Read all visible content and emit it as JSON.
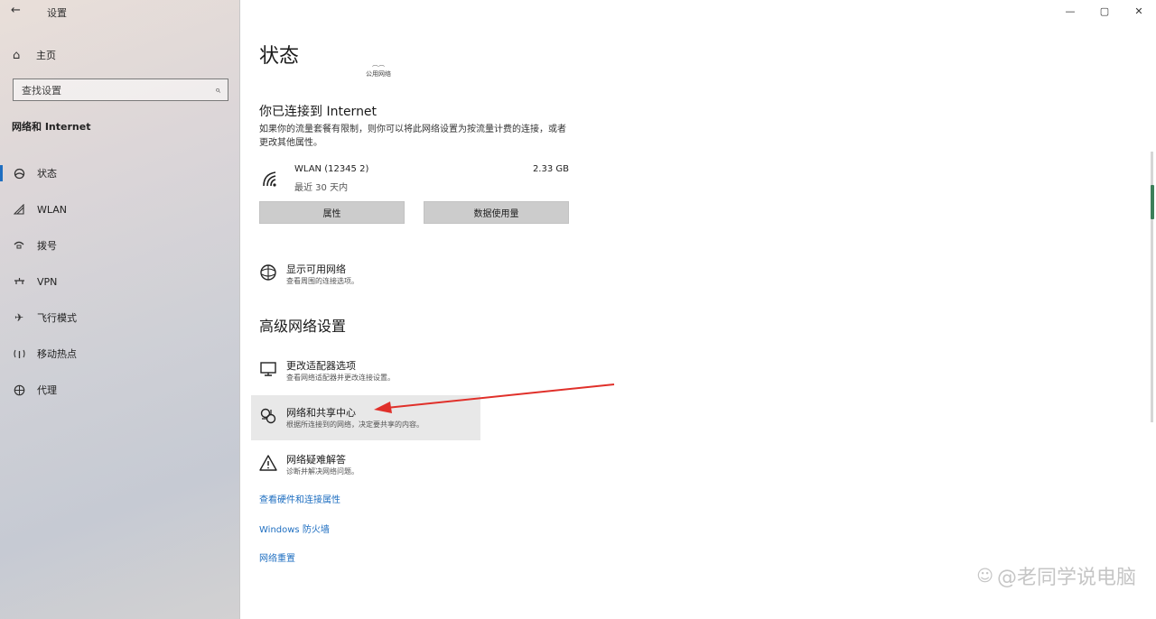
{
  "window": {
    "back_glyph": "←",
    "title": "设置",
    "controls": {
      "minimize": "—",
      "maximize": "▢",
      "close": "✕"
    }
  },
  "sidebar": {
    "home_label": "主页",
    "search_placeholder": "查找设置",
    "section_label": "网络和 Internet",
    "items": [
      {
        "label": "状态",
        "icon": "status-icon",
        "active": true
      },
      {
        "label": "WLAN",
        "icon": "wifi-icon",
        "active": false
      },
      {
        "label": "拨号",
        "icon": "dialup-icon",
        "active": false
      },
      {
        "label": "VPN",
        "icon": "vpn-icon",
        "active": false
      },
      {
        "label": "飞行模式",
        "icon": "airplane-icon",
        "active": false
      },
      {
        "label": "移动热点",
        "icon": "hotspot-icon",
        "active": false
      },
      {
        "label": "代理",
        "icon": "globe-icon",
        "active": false
      }
    ]
  },
  "main": {
    "title": "状态",
    "connection_sub": "公用网络",
    "connected_heading": "你已连接到 Internet",
    "connected_desc": "如果你的流量套餐有限制，则你可以将此网络设置为按流量计费的连接，或者更改其他属性。",
    "adapter": {
      "name": "WLAN (12345 2)",
      "since": "最近 30 天内",
      "usage": "2.33 GB"
    },
    "buttons": {
      "properties": "属性",
      "data_usage": "数据使用量"
    },
    "show_networks": {
      "title": "显示可用网络",
      "desc": "查看周围的连接选项。"
    },
    "advanced_heading": "高级网络设置",
    "advanced_items": [
      {
        "title": "更改适配器选项",
        "desc": "查看网络适配器并更改连接设置。",
        "icon": "monitor-icon"
      },
      {
        "title": "网络和共享中心",
        "desc": "根据所连接到的网络，决定要共享的内容。",
        "icon": "sharing-icon"
      },
      {
        "title": "网络疑难解答",
        "desc": "诊断并解决网络问题。",
        "icon": "warning-icon"
      }
    ],
    "links": [
      "查看硬件和连接属性",
      "Windows 防火墙",
      "网络重置"
    ]
  },
  "annotation": {
    "color": "#e0302a"
  },
  "watermark": {
    "text": "@老同学说电脑"
  },
  "colors": {
    "accent": "#1f6fc1",
    "button_bg": "#cccccc",
    "highlight_bg": "#e8e8e8"
  }
}
